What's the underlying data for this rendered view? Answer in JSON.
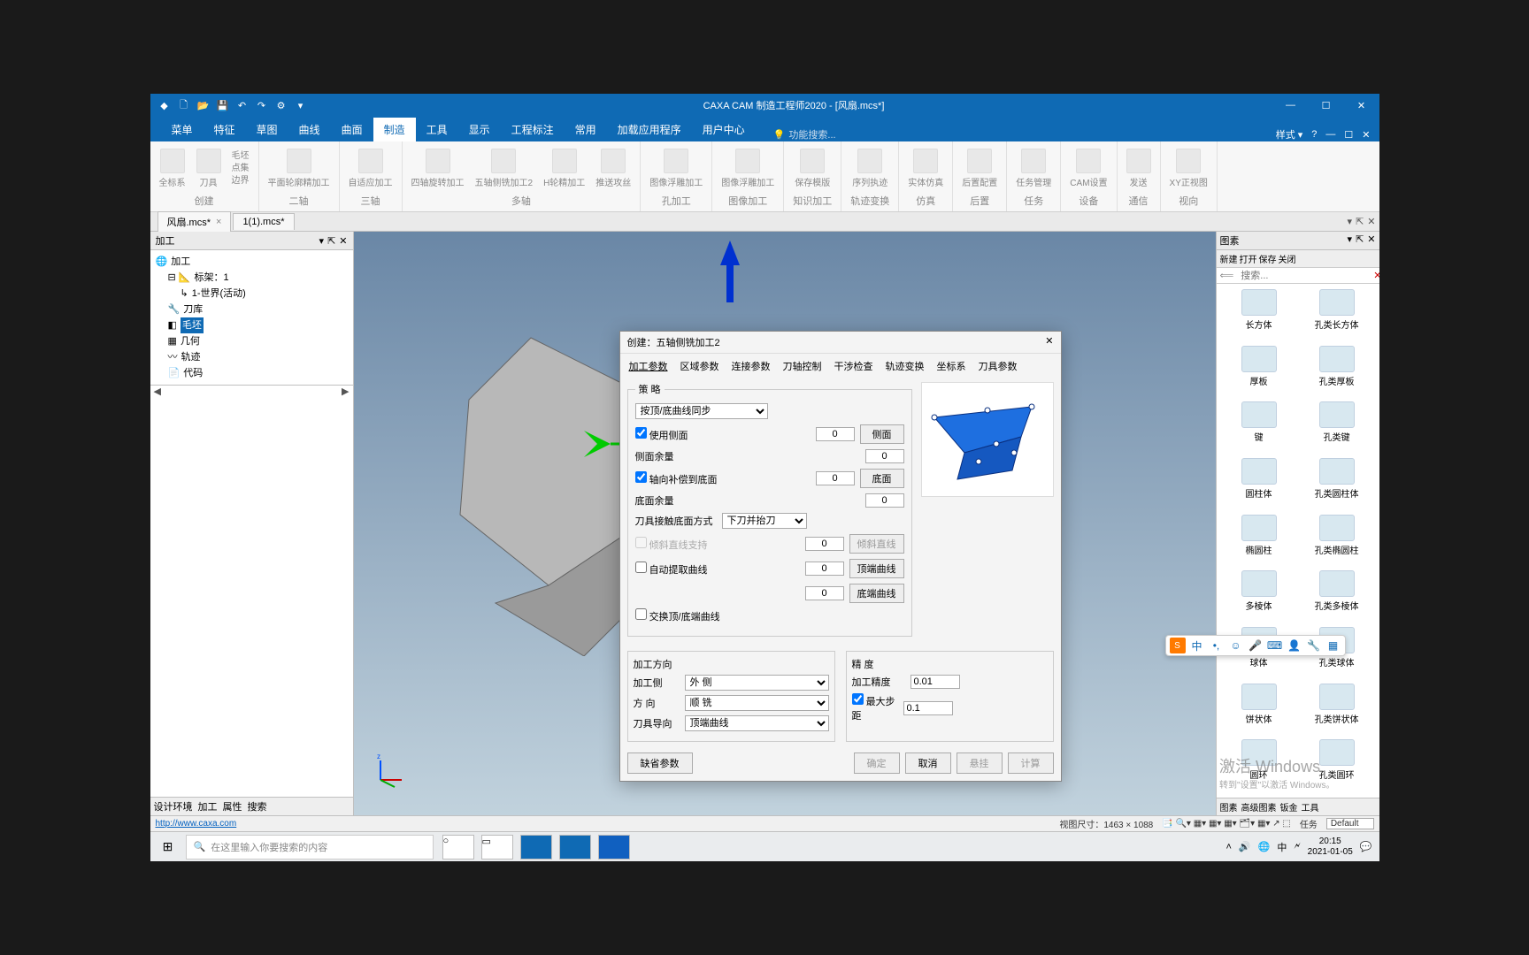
{
  "app": {
    "title": "CAXA CAM 制造工程师2020 - [风扇.mcs*]"
  },
  "ribbon_tabs": [
    "菜单",
    "特征",
    "草图",
    "曲线",
    "曲面",
    "制造",
    "工具",
    "显示",
    "工程标注",
    "常用",
    "加载应用程序",
    "用户中心"
  ],
  "ribbon_active": "制造",
  "ribbon_search_ph": "功能搜索...",
  "ribbon_right_style": "样式 ▾",
  "ribbon_groups": [
    {
      "label": "创建",
      "items": [
        "全标系",
        "刀具",
        "毛坯",
        "点集",
        "边界"
      ]
    },
    {
      "label": "二轴",
      "items": [
        "平面轮廓精加工"
      ]
    },
    {
      "label": "三轴",
      "items": [
        "自适应加工"
      ]
    },
    {
      "label": "多轴",
      "items": [
        "四轴旋转加工",
        "五轴侧铣加工2",
        "H轮精加工",
        "推送攻丝"
      ]
    },
    {
      "label": "孔加工",
      "items": [
        "图像浮雕加工"
      ]
    },
    {
      "label": "图像加工",
      "items": [
        "图像浮雕加工"
      ]
    },
    {
      "label": "知识加工",
      "items": [
        "保存模版"
      ]
    },
    {
      "label": "轨迹变换",
      "items": [
        "序列执迹"
      ]
    },
    {
      "label": "仿真",
      "items": [
        "实体仿真"
      ]
    },
    {
      "label": "后置",
      "items": [
        "后置配置"
      ]
    },
    {
      "label": "任务",
      "items": [
        "任务管理"
      ]
    },
    {
      "label": "设备",
      "items": [
        "CAM设置"
      ]
    },
    {
      "label": "通信",
      "items": [
        "发送"
      ]
    },
    {
      "label": "视向",
      "items": [
        "XY正视图"
      ]
    }
  ],
  "doctabs": [
    {
      "name": "风扇.mcs*",
      "close": "×"
    },
    {
      "name": "1(1).mcs*",
      "close": ""
    }
  ],
  "left": {
    "header": "加工",
    "tree": [
      {
        "t": "加工",
        "d": 0
      },
      {
        "t": "标架：1",
        "d": 1
      },
      {
        "t": "1-世界(活动)",
        "d": 2
      },
      {
        "t": "刀库",
        "d": 1
      },
      {
        "t": "毛坯",
        "d": 1,
        "sel": true
      },
      {
        "t": "几何",
        "d": 1
      },
      {
        "t": "轨迹",
        "d": 1
      },
      {
        "t": "代码",
        "d": 1
      }
    ],
    "btabs": [
      "设计环境",
      "加工",
      "属性",
      "搜索"
    ]
  },
  "right": {
    "header": "图素",
    "toolbar": [
      "新建",
      "打开",
      "保存",
      "关闭"
    ],
    "search_ph": "搜索...",
    "items": [
      "长方体",
      "孔类长方体",
      "厚板",
      "孔类厚板",
      "键",
      "孔类键",
      "圆柱体",
      "孔类圆柱体",
      "椭圆柱",
      "孔类椭圆柱",
      "多棱体",
      "孔类多棱体",
      "球体",
      "孔类球体",
      "饼状体",
      "孔类饼状体",
      "圆环",
      "孔类圆环"
    ],
    "btabs": [
      "图素",
      "高级图素",
      "钣金",
      "工具"
    ]
  },
  "dialog": {
    "title": "创建：五轴侧铣加工2",
    "tabs": [
      "加工参数",
      "区域参数",
      "连接参数",
      "刀轴控制",
      "干涉检查",
      "轨迹变换",
      "坐标系",
      "刀具参数"
    ],
    "strategy_legend": "策 略",
    "strategy_select": "按顶/底曲线同步",
    "use_side": "使用侧面",
    "use_side_v": "0",
    "side_btn": "侧面",
    "side_margin": "侧面余量",
    "side_margin_v": "0",
    "axial_comp": "轴向补偿到底面",
    "axial_comp_v": "0",
    "bottom_btn": "底面",
    "bottom_margin": "底面余量",
    "bottom_margin_v": "0",
    "contact": "刀具接触底面方式",
    "contact_v": "下刀并抬刀",
    "tilt": "倾斜直线支持",
    "tilt_v": "0",
    "tilt_btn": "倾斜直线",
    "auto_extract": "自动提取曲线",
    "auto_extract_v": "0",
    "top_curve_btn": "顶端曲线",
    "auto_extract_v2": "0",
    "bot_curve_btn": "底端曲线",
    "swap_curves": "交换顶/底端曲线",
    "dir_legend": "加工方向",
    "machining_side": "加工侧",
    "machining_side_v": "外 侧",
    "direction": "方 向",
    "direction_v": "顺 铣",
    "tool_guide": "刀具导向",
    "tool_guide_v": "顶端曲线",
    "precision_legend": "精 度",
    "precision_lbl": "加工精度",
    "precision_v": "0.01",
    "maxstep_lbl": "最大步距",
    "maxstep_v": "0.1",
    "defaults_btn": "缺省参数",
    "ok": "确定",
    "cancel": "取消",
    "pause": "悬挂",
    "calc": "计算"
  },
  "status": {
    "link": "http://www.caxa.com",
    "view": "视图尺寸：1463 × 1088",
    "task": "任务",
    "default": "Default"
  },
  "watermark": {
    "l1": "激活 Windows",
    "l2": "转到\"设置\"以激活 Windows。"
  },
  "taskbar": {
    "search_ph": "在这里输入你要搜索的内容",
    "time": "20:15",
    "date": "2021-01-05"
  }
}
